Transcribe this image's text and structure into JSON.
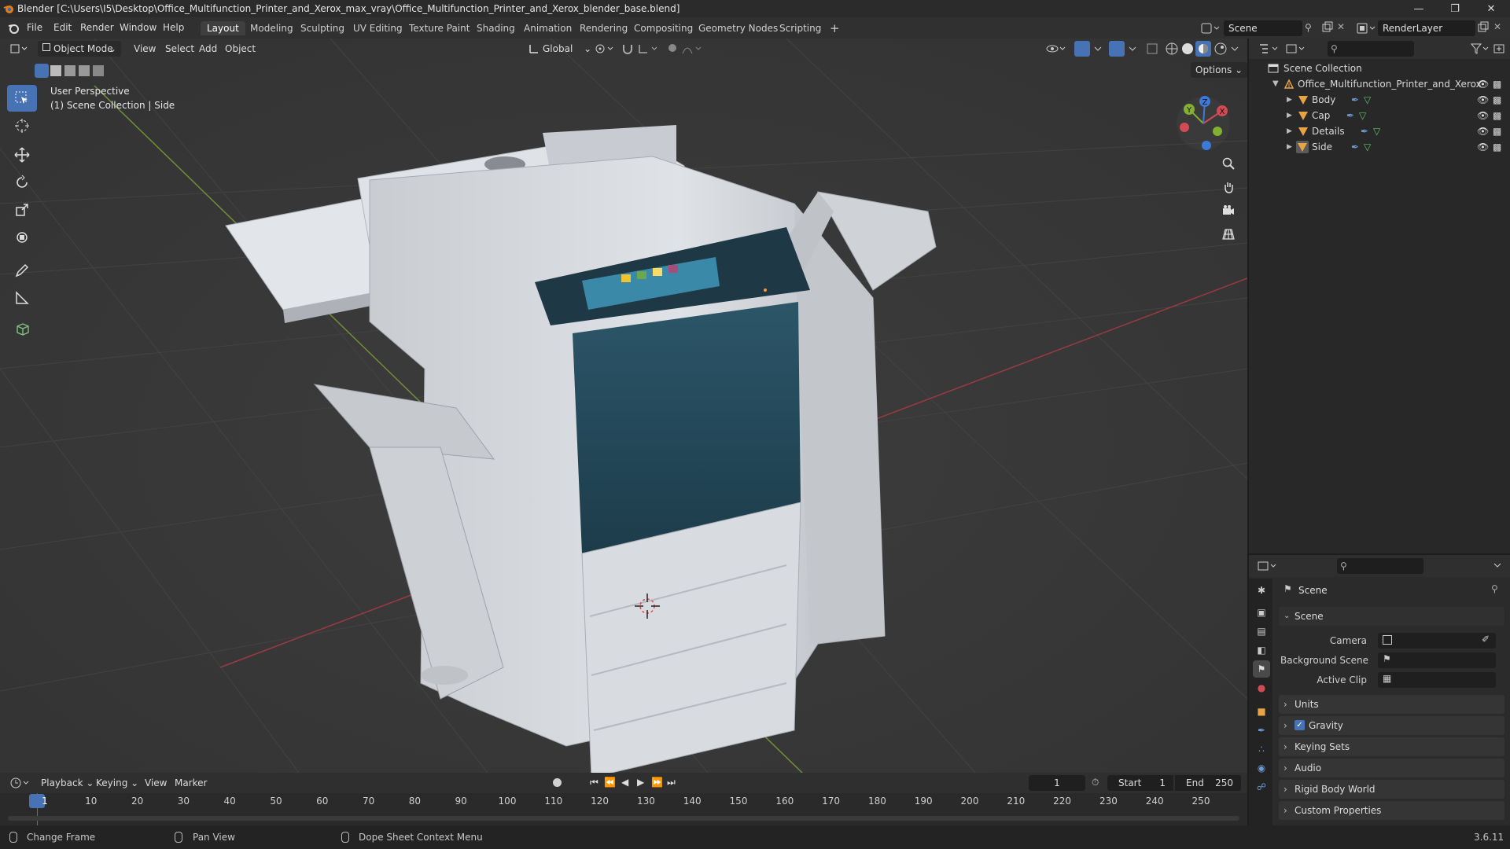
{
  "window": {
    "title": "Blender [C:\\Users\\I5\\Desktop\\Office_Multifunction_Printer_and_Xerox_max_vray\\Office_Multifunction_Printer_and_Xerox_blender_base.blend]"
  },
  "menus": [
    "File",
    "Edit",
    "Render",
    "Window",
    "Help"
  ],
  "workspaces": [
    "Layout",
    "Modeling",
    "Sculpting",
    "UV Editing",
    "Texture Paint",
    "Shading",
    "Animation",
    "Rendering",
    "Compositing",
    "Geometry Nodes",
    "Scripting"
  ],
  "active_workspace": "Layout",
  "scene_field": "Scene",
  "render_layer_field": "RenderLayer",
  "viewport": {
    "mode": "Object Mode",
    "menus": [
      "View",
      "Select",
      "Add",
      "Object"
    ],
    "orientation": "Global",
    "options_label": "Options",
    "overlay_line1": "User Perspective",
    "overlay_line2": "(1) Scene Collection | Side",
    "gizmo": {
      "x": "X",
      "y": "Y",
      "z": "Z"
    }
  },
  "outliner": {
    "root": "Scene Collection",
    "collection": "Office_Multifunction_Printer_and_Xerox",
    "objects": [
      "Body",
      "Cap",
      "Details",
      "Side"
    ]
  },
  "properties": {
    "header": "Scene",
    "panel": "Scene",
    "fields": [
      {
        "label": "Camera"
      },
      {
        "label": "Background Scene"
      },
      {
        "label": "Active Clip"
      }
    ],
    "collapsed_panels": [
      "Units",
      "Gravity",
      "Keying Sets",
      "Audio",
      "Rigid Body World",
      "Custom Properties"
    ],
    "gravity_checked": true
  },
  "timeline": {
    "menus": [
      "Playback",
      "Keying",
      "View",
      "Marker"
    ],
    "current_frame": "1",
    "start_label": "Start",
    "start_value": "1",
    "end_label": "End",
    "end_value": "250",
    "ticks": [
      "1",
      "10",
      "20",
      "30",
      "40",
      "50",
      "60",
      "70",
      "80",
      "90",
      "100",
      "110",
      "120",
      "130",
      "140",
      "150",
      "160",
      "170",
      "180",
      "190",
      "200",
      "210",
      "220",
      "230",
      "240",
      "250"
    ]
  },
  "statusbar": {
    "left": "Change Frame",
    "middle": "Pan View",
    "right": "Dope Sheet Context Menu",
    "version": "3.6.11"
  },
  "colors": {
    "accent": "#4772b3",
    "x_axis": "#d24a54",
    "y_axis": "#82b032",
    "z_axis": "#3d7ad8",
    "playhead": "#4772b3"
  }
}
